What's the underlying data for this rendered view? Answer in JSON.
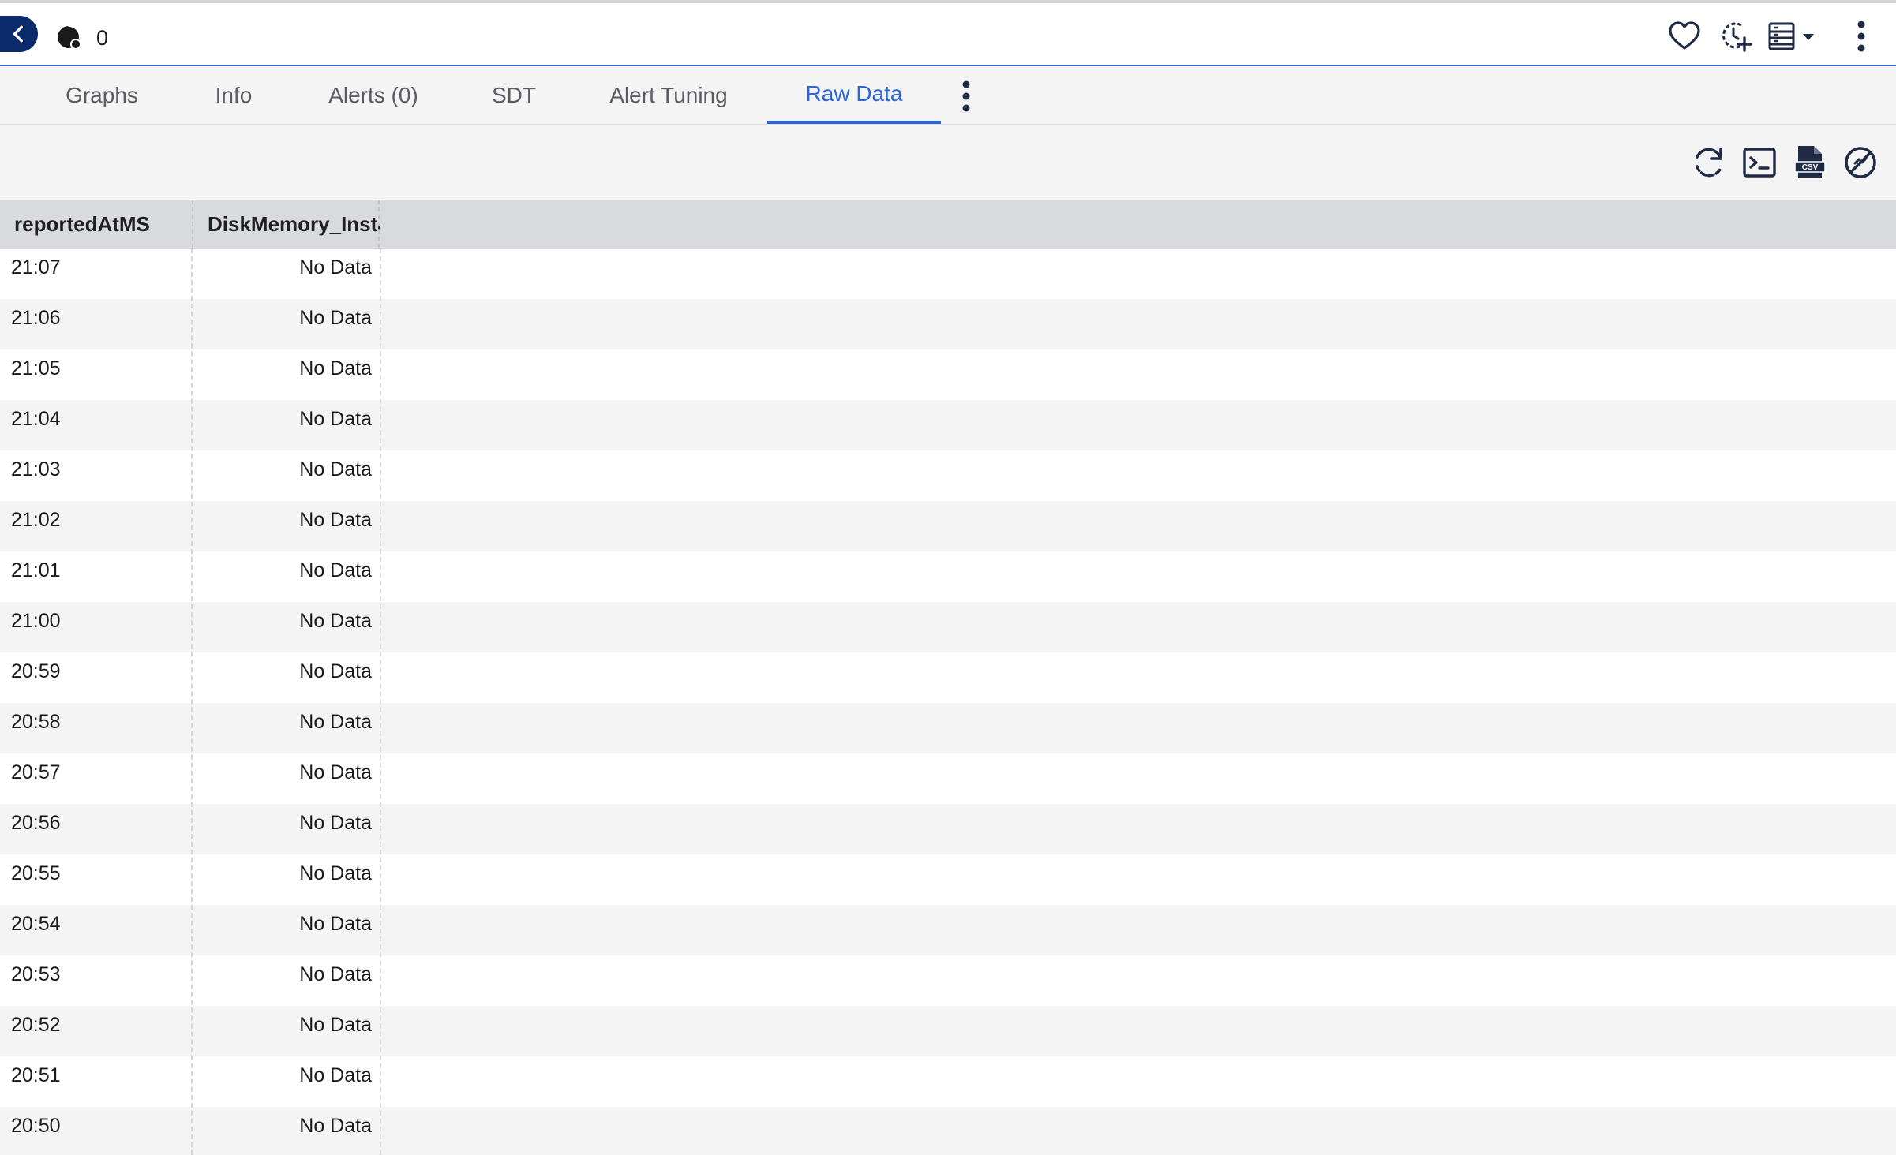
{
  "header": {
    "status_count": "0"
  },
  "tabs": [
    {
      "label": "Graphs"
    },
    {
      "label": "Info"
    },
    {
      "label": "Alerts (0)"
    },
    {
      "label": "SDT"
    },
    {
      "label": "Alert Tuning"
    },
    {
      "label": "Raw Data"
    }
  ],
  "active_tab": "Raw Data",
  "toolbar": {
    "export_badge": "CSV"
  },
  "table": {
    "columns": [
      "reportedAtMS",
      "DiskMemory_Insta"
    ],
    "rows": [
      {
        "time": "21:07",
        "value": "No Data"
      },
      {
        "time": "21:06",
        "value": "No Data"
      },
      {
        "time": "21:05",
        "value": "No Data"
      },
      {
        "time": "21:04",
        "value": "No Data"
      },
      {
        "time": "21:03",
        "value": "No Data"
      },
      {
        "time": "21:02",
        "value": "No Data"
      },
      {
        "time": "21:01",
        "value": "No Data"
      },
      {
        "time": "21:00",
        "value": "No Data"
      },
      {
        "time": "20:59",
        "value": "No Data"
      },
      {
        "time": "20:58",
        "value": "No Data"
      },
      {
        "time": "20:57",
        "value": "No Data"
      },
      {
        "time": "20:56",
        "value": "No Data"
      },
      {
        "time": "20:55",
        "value": "No Data"
      },
      {
        "time": "20:54",
        "value": "No Data"
      },
      {
        "time": "20:53",
        "value": "No Data"
      },
      {
        "time": "20:52",
        "value": "No Data"
      },
      {
        "time": "20:51",
        "value": "No Data"
      },
      {
        "time": "20:50",
        "value": "No Data"
      }
    ]
  },
  "icons": {
    "back": "chevron-left-icon",
    "status": "status-dot-icon",
    "favorite": "heart-icon",
    "add_schedule": "clock-plus-icon",
    "view_menu": "list-view-icon",
    "more": "vertical-ellipsis-icon",
    "refresh": "refresh-icon",
    "terminal": "terminal-icon",
    "csv": "csv-file-icon",
    "disable": "slash-circle-icon"
  },
  "colors": {
    "accent": "#2a66d9",
    "navy": "#0a2a6b",
    "header_row": "#d9dadd",
    "alt_row": "#f4f4f5"
  }
}
